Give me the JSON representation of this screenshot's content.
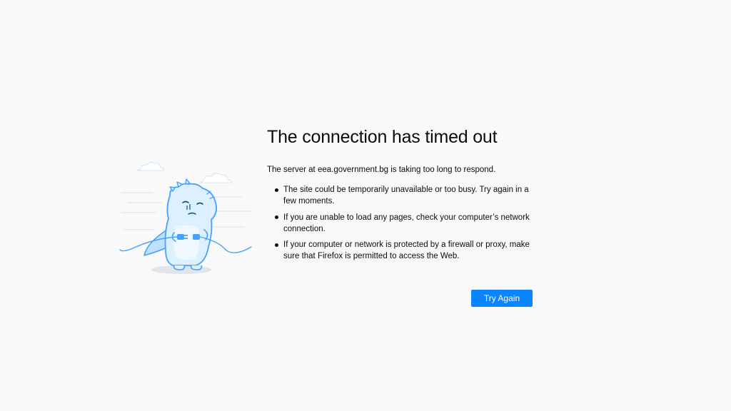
{
  "error": {
    "title": "The connection has timed out",
    "intro": "The server at eea.government.bg is taking too long to respond.",
    "bullets": [
      {
        "text": "The site could be temporarily unavailable or too busy. Try again in a few moments."
      },
      {
        "text": "If you are unable to load any pages, check your computer’s network connection."
      },
      {
        "text": "If your computer or network is protected by a firewall or proxy, make sure that Firefox is permitted to access the Web."
      }
    ],
    "try_again_label": "Try Again"
  },
  "colors": {
    "background": "#f9f9fa",
    "accent": "#0a84ff",
    "text": "#0c0c0d",
    "illustration": "#45a1ff"
  },
  "illustration": {
    "icon": "disconnected-dino-illustration"
  }
}
